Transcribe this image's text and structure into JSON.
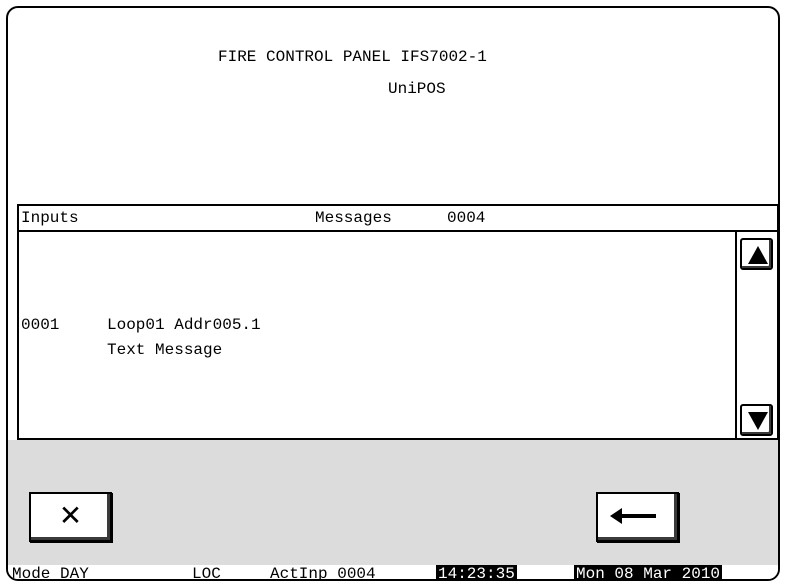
{
  "header": {
    "title_line1": "FIRE CONTROL PANEL IFS7002-1",
    "title_line2": "UniPOS"
  },
  "panel": {
    "inputs_label": "Inputs",
    "messages_label": "Messages",
    "messages_count": "0004",
    "messages": [
      {
        "number": "0001",
        "location": "Loop01 Addr005.1",
        "text": "Text Message"
      }
    ]
  },
  "buttons": {
    "cancel_icon": "close-icon",
    "back_icon": "arrow-left-icon"
  },
  "status_bar": {
    "mode": "Mode DAY",
    "loc": "LOC",
    "actinp": "ActInp 0004",
    "time": "14:23:35",
    "date": "Mon 08 Mar 2010"
  },
  "colors": {
    "button_area": "#dcdcdc",
    "highlight": "#000000"
  }
}
